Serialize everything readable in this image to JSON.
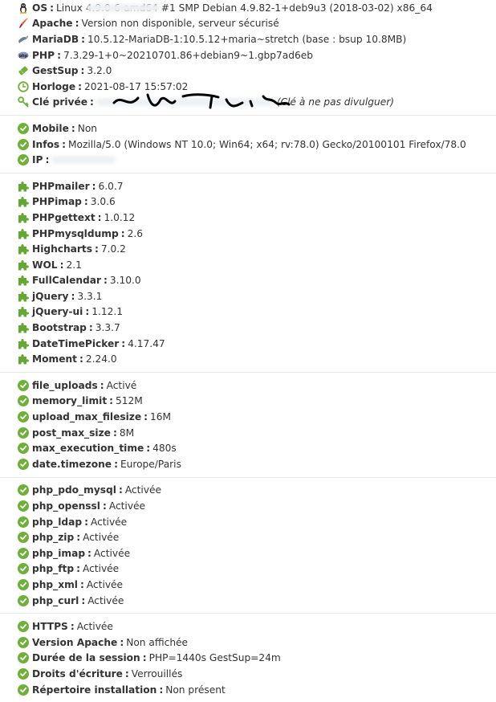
{
  "system": {
    "rows": [
      {
        "id": "os",
        "icon": "linux-icon",
        "label": "OS",
        "value": "Linux                4.9.0-6-amd64 #1 SMP Debian 4.9.82-1+deb9u3 (2018-03-02) x86_64"
      },
      {
        "id": "apache",
        "icon": "feather-icon",
        "label": "Apache",
        "value": "Version non disponible, serveur sécurisé"
      },
      {
        "id": "mariadb",
        "icon": "mariadb-icon",
        "label": "MariaDB",
        "value": "10.5.12-MariaDB-1:10.5.12+maria~stretch (base : bsup 10.8MB)"
      },
      {
        "id": "php",
        "icon": "php-icon",
        "label": "PHP",
        "value": "7.3.29-1+0~20210701.86+debian9~1.gbp7ad6eb"
      },
      {
        "id": "gestsup",
        "icon": "ticket-icon",
        "label": "GestSup",
        "value": "3.2.0"
      },
      {
        "id": "horloge",
        "icon": "clock-icon",
        "label": "Horloge",
        "value": "2021-08-17 15:57:02"
      },
      {
        "id": "cle",
        "icon": "key-icon",
        "label": "Clé privée",
        "value": "",
        "note": "(Clé à ne pas divulguer)"
      }
    ]
  },
  "client": {
    "rows": [
      {
        "label": "Mobile",
        "value": "Non"
      },
      {
        "label": "Infos",
        "value": "Mozilla/5.0 (Windows NT 10.0; Win64; x64; rv:78.0) Gecko/20100101 Firefox/78.0"
      },
      {
        "label": "IP",
        "value": ""
      }
    ]
  },
  "components": {
    "rows": [
      {
        "label": "PHPmailer",
        "value": "6.0.7"
      },
      {
        "label": "PHPimap",
        "value": "3.0.6"
      },
      {
        "label": "PHPgettext",
        "value": "1.0.12"
      },
      {
        "label": "PHPmysqldump",
        "value": "2.6"
      },
      {
        "label": "Highcharts",
        "value": "7.0.2"
      },
      {
        "label": "WOL",
        "value": "2.1"
      },
      {
        "label": "FullCalendar",
        "value": "3.10.0"
      },
      {
        "label": "jQuery",
        "value": "3.3.1"
      },
      {
        "label": "jQuery-ui",
        "value": "1.12.1"
      },
      {
        "label": "Bootstrap",
        "value": "3.3.7"
      },
      {
        "label": "DateTimePicker",
        "value": "4.17.47"
      },
      {
        "label": "Moment",
        "value": "2.24.0"
      }
    ]
  },
  "php_settings": {
    "rows": [
      {
        "label": "file_uploads",
        "value": "Activé"
      },
      {
        "label": "memory_limit",
        "value": "512M"
      },
      {
        "label": "upload_max_filesize",
        "value": "16M"
      },
      {
        "label": "post_max_size",
        "value": "8M"
      },
      {
        "label": "max_execution_time",
        "value": "480s"
      },
      {
        "label": "date.timezone",
        "value": "Europe/Paris"
      }
    ]
  },
  "php_extensions": {
    "rows": [
      {
        "label": "php_pdo_mysql",
        "value": "Activée"
      },
      {
        "label": "php_openssl",
        "value": "Activée"
      },
      {
        "label": "php_ldap",
        "value": "Activée"
      },
      {
        "label": "php_zip",
        "value": "Activée"
      },
      {
        "label": "php_imap",
        "value": "Activée"
      },
      {
        "label": "php_ftp",
        "value": "Activée"
      },
      {
        "label": "php_xml",
        "value": "Activée"
      },
      {
        "label": "php_curl",
        "value": "Activée"
      }
    ]
  },
  "security": {
    "rows": [
      {
        "label": "HTTPS",
        "value": "Activée"
      },
      {
        "label": "Version Apache",
        "value": "Non affichée"
      },
      {
        "label": "Durée de la session",
        "value": "PHP=1440s GestSup=24m"
      },
      {
        "label": "Droits d'écriture",
        "value": "Verrouillés"
      },
      {
        "label": "Répertoire installation",
        "value": "Non présent"
      }
    ]
  },
  "colors": {
    "check": "#6fb03a",
    "puzzle": "#63a832"
  }
}
